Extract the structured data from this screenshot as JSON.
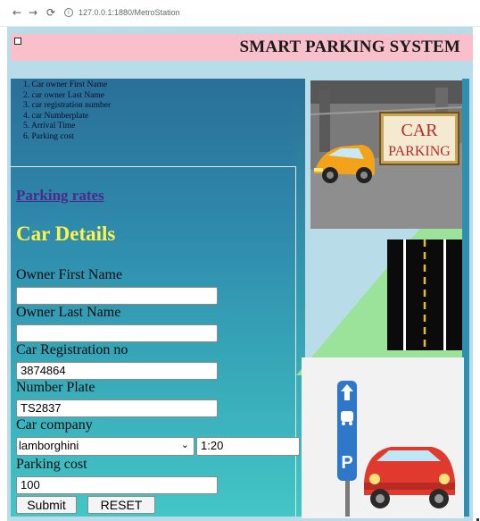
{
  "browser": {
    "url": "127.0.0.1:1880/MetroStation",
    "back_icon": "arrow-left",
    "forward_icon": "arrow-right",
    "reload_icon": "reload"
  },
  "header": {
    "title": "SMART PARKING SYSTEM",
    "background": "#f9c0cb"
  },
  "info_list": [
    "1. Car owner First Name",
    "2. car owner Last Name",
    "3. car registration number",
    "4. car Numberplate",
    "5. Arrival Time",
    "6. Parking cost"
  ],
  "links": {
    "parking_rates": "Parking rates"
  },
  "form": {
    "title": "Car Details",
    "first_name": {
      "label": "Owner First Name",
      "value": ""
    },
    "last_name": {
      "label": "Owner Last Name",
      "value": ""
    },
    "registration": {
      "label": "Car Registration no",
      "value": "3874864"
    },
    "number_plate": {
      "label": "Number Plate",
      "value": "TS2837"
    },
    "company": {
      "label": "Car company",
      "selected": "lamborghini",
      "time_value": "1:20"
    },
    "parking_cost": {
      "label": "Parking cost",
      "value": "100"
    },
    "submit_label": "Submit",
    "reset_label": "RESET"
  },
  "images": {
    "car_parking_sign_text_1": "CAR",
    "car_parking_sign_text_2": "PARKING"
  },
  "colors": {
    "title_yellow": "#fff34a",
    "link_purple": "#4b2a8a"
  }
}
